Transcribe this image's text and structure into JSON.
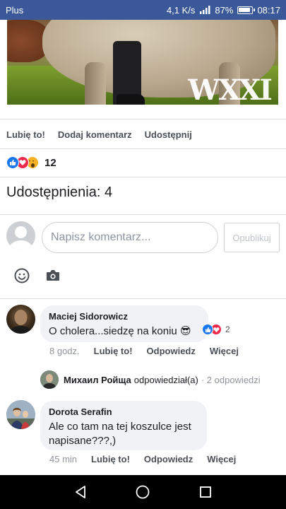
{
  "status_bar": {
    "carrier": "Plus",
    "network_speed": "4,1 K/s",
    "battery_percent": "87%",
    "time": "08:17"
  },
  "photo": {
    "logo_text": "WXXI"
  },
  "post_actions": {
    "like": "Lubię to!",
    "comment": "Dodaj komentarz",
    "share": "Udostępnij"
  },
  "reactions": {
    "types": [
      "like-icon",
      "love-icon",
      "wow-icon"
    ],
    "count": "12"
  },
  "shares_text": "Udostępnienia: 4",
  "composer": {
    "placeholder": "Napisz komentarz...",
    "publish_label": "Opublikuj"
  },
  "comments": [
    {
      "author": "Maciej Sidorowicz",
      "text": "O cholera...siedzę na koniu 😎",
      "time": "8 godz.",
      "like_label": "Lubię to!",
      "reply_label": "Odpowiedz",
      "more_label": "Więcej",
      "reaction_count": "2",
      "reply_summary": {
        "author": "Михаил Ройща",
        "action": "odpowiedział(a)",
        "count": "· 2 odpowiedzi"
      }
    },
    {
      "author": "Dorota Serafin",
      "text": "Ale co tam na tej koszulce jest napisane???,)",
      "time": "45 min",
      "like_label": "Lubię to!",
      "reply_label": "Odpowiedz",
      "more_label": "Więcej"
    }
  ],
  "colors": {
    "status_bar": "#3b5998",
    "like_blue": "#1877f2",
    "love_red": "#f0284a",
    "wow_yellow": "#f7b125",
    "bubble_bg": "#f0f2f5"
  }
}
